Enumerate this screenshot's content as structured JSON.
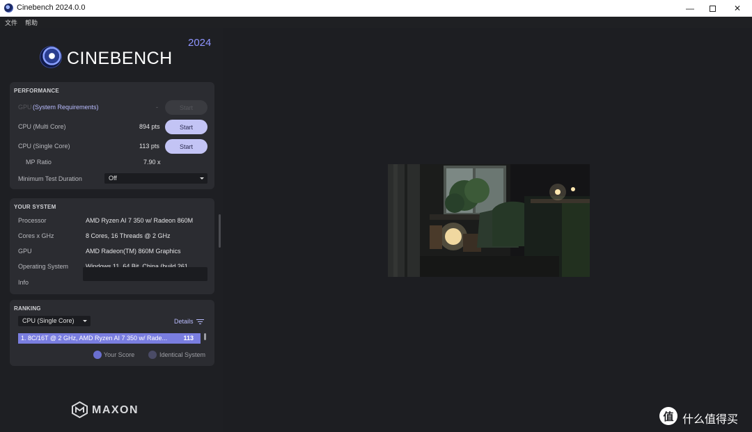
{
  "window": {
    "title": "Cinebench 2024.0.0"
  },
  "menu": [
    "文件",
    "帮助"
  ],
  "logo": {
    "text": "CINEBENCH",
    "year": "2024"
  },
  "performance": {
    "title": "PERFORMANCE",
    "gpu": {
      "label_prefix": "GPU",
      "label_link": "(System Requirements)",
      "value": "-",
      "button": "Start"
    },
    "cpu_multi": {
      "label": "CPU (Multi Core)",
      "value": "894 pts",
      "button": "Start"
    },
    "cpu_single": {
      "label": "CPU (Single Core)",
      "value": "113 pts",
      "button": "Start"
    },
    "mp_ratio": {
      "label": "MP Ratio",
      "value": "7.90 x"
    },
    "min_duration": {
      "label": "Minimum Test Duration",
      "value": "Off"
    }
  },
  "system": {
    "title": "YOUR SYSTEM",
    "rows": [
      {
        "label": "Processor",
        "value": "AMD Ryzen AI 7 350 w/ Radeon 860M"
      },
      {
        "label": "Cores x GHz",
        "value": "8 Cores, 16 Threads @ 2 GHz"
      },
      {
        "label": "GPU",
        "value": "AMD Radeon(TM) 860M Graphics"
      },
      {
        "label": "Operating System",
        "value": "Windows 11, 64 Bit, China (build 261..."
      },
      {
        "label": "Info",
        "value": ""
      }
    ]
  },
  "ranking": {
    "title": "RANKING",
    "filter": "CPU (Single Core)",
    "details": "Details",
    "entries": [
      {
        "text": "1. 8C/16T @ 2 GHz, AMD Ryzen AI 7 350 w/ Rade...",
        "score": "113"
      }
    ],
    "legend": [
      {
        "label": "Your Score",
        "color": "#6a6fd0"
      },
      {
        "label": "Identical System",
        "color": "#4a4b66"
      }
    ]
  },
  "brand": {
    "maxon": "MAXON"
  },
  "watermark": {
    "icon": "值",
    "text": "什么值得买"
  },
  "colors": {
    "accent": "#8f95ff",
    "button": "#c3c4f5",
    "ranking_highlight": "#7a7ee0"
  }
}
